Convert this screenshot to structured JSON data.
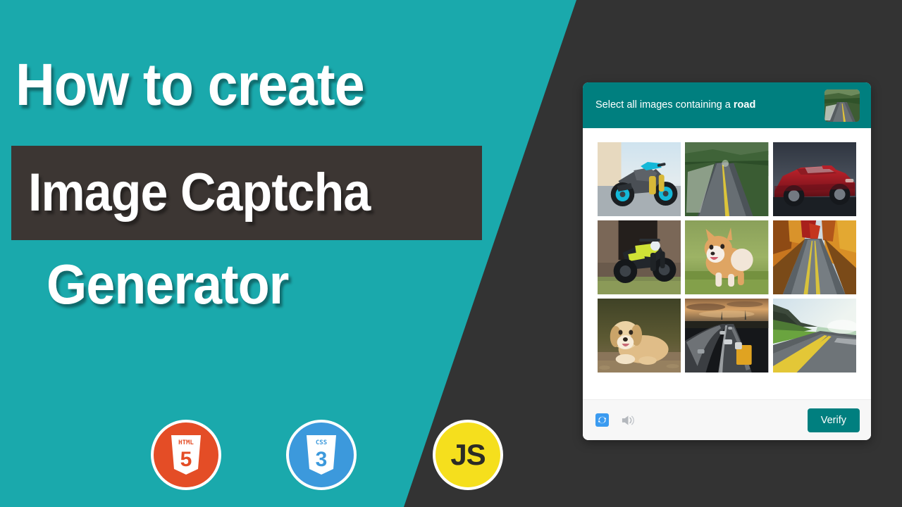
{
  "hero": {
    "line1": "How to create",
    "line2": "Image Captcha",
    "line3": "Generator",
    "band_color": "#3C3633",
    "panel_color": "#1AA9AC",
    "dark_color": "#333333"
  },
  "logos": [
    {
      "name": "html5",
      "label": "HTML",
      "mark": "5",
      "color": "#E44D26"
    },
    {
      "name": "css3",
      "label": "CSS",
      "mark": "3",
      "color": "#3C99DC"
    },
    {
      "name": "javascript",
      "label": "JS",
      "mark": "JS",
      "color": "#F5DF1D"
    }
  ],
  "captcha": {
    "header": {
      "prompt_prefix": "Select all images containing a ",
      "prompt_target": "road",
      "thumbnail_alt": "forest-road-thumbnail",
      "bg_color": "#007F7F"
    },
    "grid": [
      {
        "id": 1,
        "alt": "blue motorcycle",
        "contains_road": false
      },
      {
        "id": 2,
        "alt": "green forest road",
        "contains_road": true
      },
      {
        "id": 3,
        "alt": "red convertible car",
        "contains_road": false
      },
      {
        "id": 4,
        "alt": "yellow green motorcycle",
        "contains_road": false
      },
      {
        "id": 5,
        "alt": "corgi dog on grass",
        "contains_road": false
      },
      {
        "id": 6,
        "alt": "autumn tree lined road",
        "contains_road": true
      },
      {
        "id": 7,
        "alt": "golden retriever dog",
        "contains_road": false
      },
      {
        "id": 8,
        "alt": "highway at dusk with truck",
        "contains_road": true
      },
      {
        "id": 9,
        "alt": "mountain highway",
        "contains_road": true
      }
    ],
    "footer": {
      "refresh_icon": "refresh-icon",
      "audio_icon": "audio-speaker-icon",
      "verify_label": "Verify",
      "verify_color": "#007F7F",
      "refresh_color": "#3B9BF0"
    }
  }
}
